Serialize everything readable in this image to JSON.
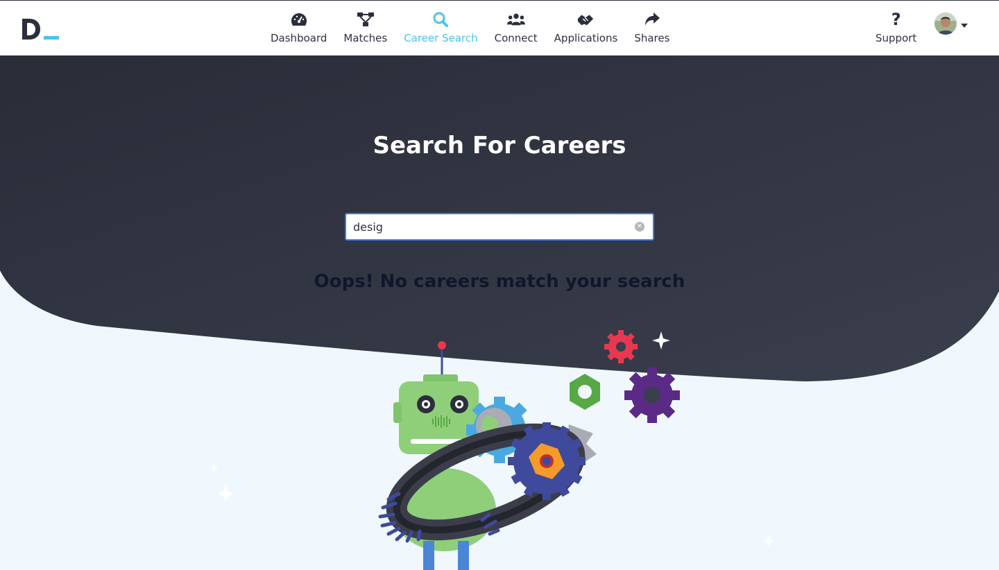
{
  "app": {
    "logo_text": "D_"
  },
  "nav": {
    "items": [
      {
        "label": "Dashboard",
        "icon": "dashboard-gauge-icon"
      },
      {
        "label": "Matches",
        "icon": "matches-sitemap-icon"
      },
      {
        "label": "Career Search",
        "icon": "search-icon",
        "active": true
      },
      {
        "label": "Connect",
        "icon": "people-group-icon"
      },
      {
        "label": "Applications",
        "icon": "handshake-icon"
      },
      {
        "label": "Shares",
        "icon": "share-arrow-icon"
      }
    ],
    "support_label": "Support"
  },
  "hero": {
    "title": "Search For Careers"
  },
  "search": {
    "value": "desig"
  },
  "results": {
    "empty_message": "Oops! No careers match your search"
  },
  "colors": {
    "accent": "#4cc3e9",
    "hero_dark": "#2b2f3c",
    "page_light": "#f0f8fd",
    "input_focus": "#3b7bde"
  }
}
